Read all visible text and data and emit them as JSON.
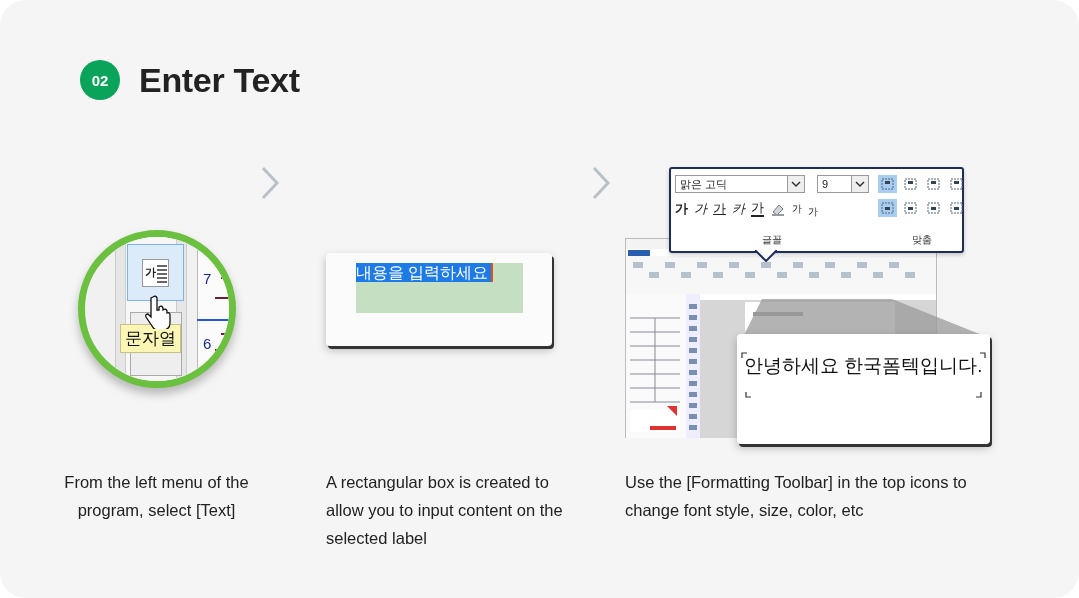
{
  "header": {
    "step_number": "02",
    "title": "Enter Text"
  },
  "steps": [
    {
      "kind": "tool-zoom",
      "tool_icon_label": "가",
      "ruler_labels": [
        "7",
        "6"
      ],
      "tooltip": "문자열",
      "caption": "From the left menu of the program, select [Text]"
    },
    {
      "kind": "text-box",
      "selected_text": "내용을 입력하세요",
      "caption": "A rectangular box is created to allow you to input content on the selected label"
    },
    {
      "kind": "toolbar",
      "toolbar": {
        "font_field": "맑은 고딕",
        "size_field": "9",
        "style_buttons": [
          {
            "label": "가",
            "kind": "bold"
          },
          {
            "label": "가",
            "kind": "italic"
          },
          {
            "label": "가",
            "kind": "underline"
          },
          {
            "label": "카",
            "kind": "strike"
          },
          {
            "label": "가",
            "kind": "color"
          },
          {
            "label": "가",
            "kind": "superscript"
          },
          {
            "label": "가",
            "kind": "subscript"
          }
        ],
        "groups": [
          "글꼴",
          "맞춤"
        ],
        "align_buttons": [
          {
            "selected": true
          },
          {
            "selected": false
          },
          {
            "selected": false
          },
          {
            "selected": false
          },
          {
            "selected": true
          },
          {
            "selected": false
          },
          {
            "selected": false
          },
          {
            "selected": false
          }
        ]
      },
      "zoom_text": "안녕하세요 한국폼텍입니다.",
      "caption": "Use the [Formatting Toolbar] in the top icons to change font style, size, color, etc"
    }
  ]
}
